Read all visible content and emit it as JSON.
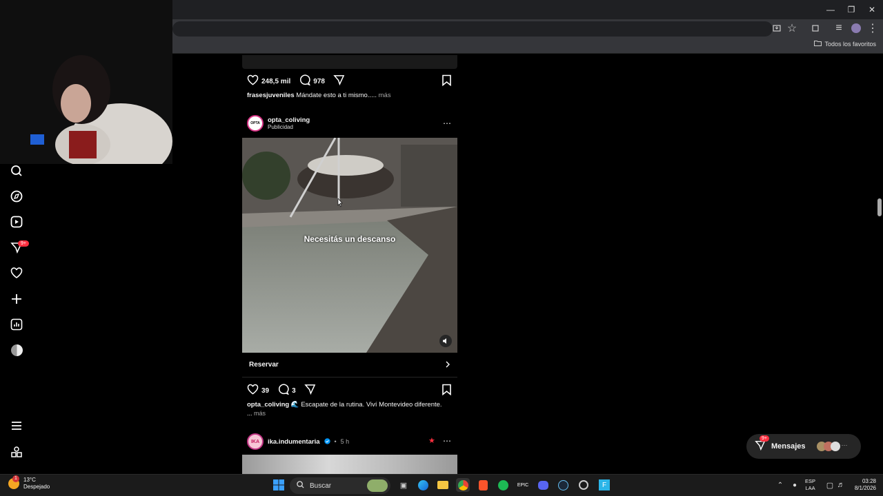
{
  "browser": {
    "bookmarks_folder": "Todos los favoritos"
  },
  "sidebar": {
    "notifications_badge": "9+"
  },
  "post_top": {
    "likes": "248,5 mil",
    "comments": "978",
    "caption_user": "frasesjuveniles",
    "caption_text": "Mándate esto a ti mismo.....",
    "more": "más"
  },
  "ad_post": {
    "username": "opta_coliving",
    "subtitle": "Publicidad",
    "avatar_text": "OPTA",
    "overlay_text": "Necesitás un descanso",
    "cta_label": "Reservar",
    "likes": "39",
    "comments": "3",
    "caption_user": "opta_coliving",
    "caption_text": "🌊 Escapate de la rutina. Viví Montevideo diferente.",
    "ellipsis": "...",
    "more": "más"
  },
  "next_post": {
    "username": "ika.indumentaria",
    "avatar_text": "IKA",
    "time": "5 h"
  },
  "messages": {
    "label": "Mensajes",
    "badge": "9+"
  },
  "taskbar": {
    "weather_temp": "13°C",
    "weather_desc": "Despejado",
    "weather_badge": "1",
    "search_placeholder": "Buscar",
    "lang_top": "ESP",
    "lang_bottom": "LAA",
    "time": "03:28",
    "date": "8/1/2026"
  },
  "colors": {
    "accent_pink": "#ff3040",
    "verified": "#0095f6"
  }
}
